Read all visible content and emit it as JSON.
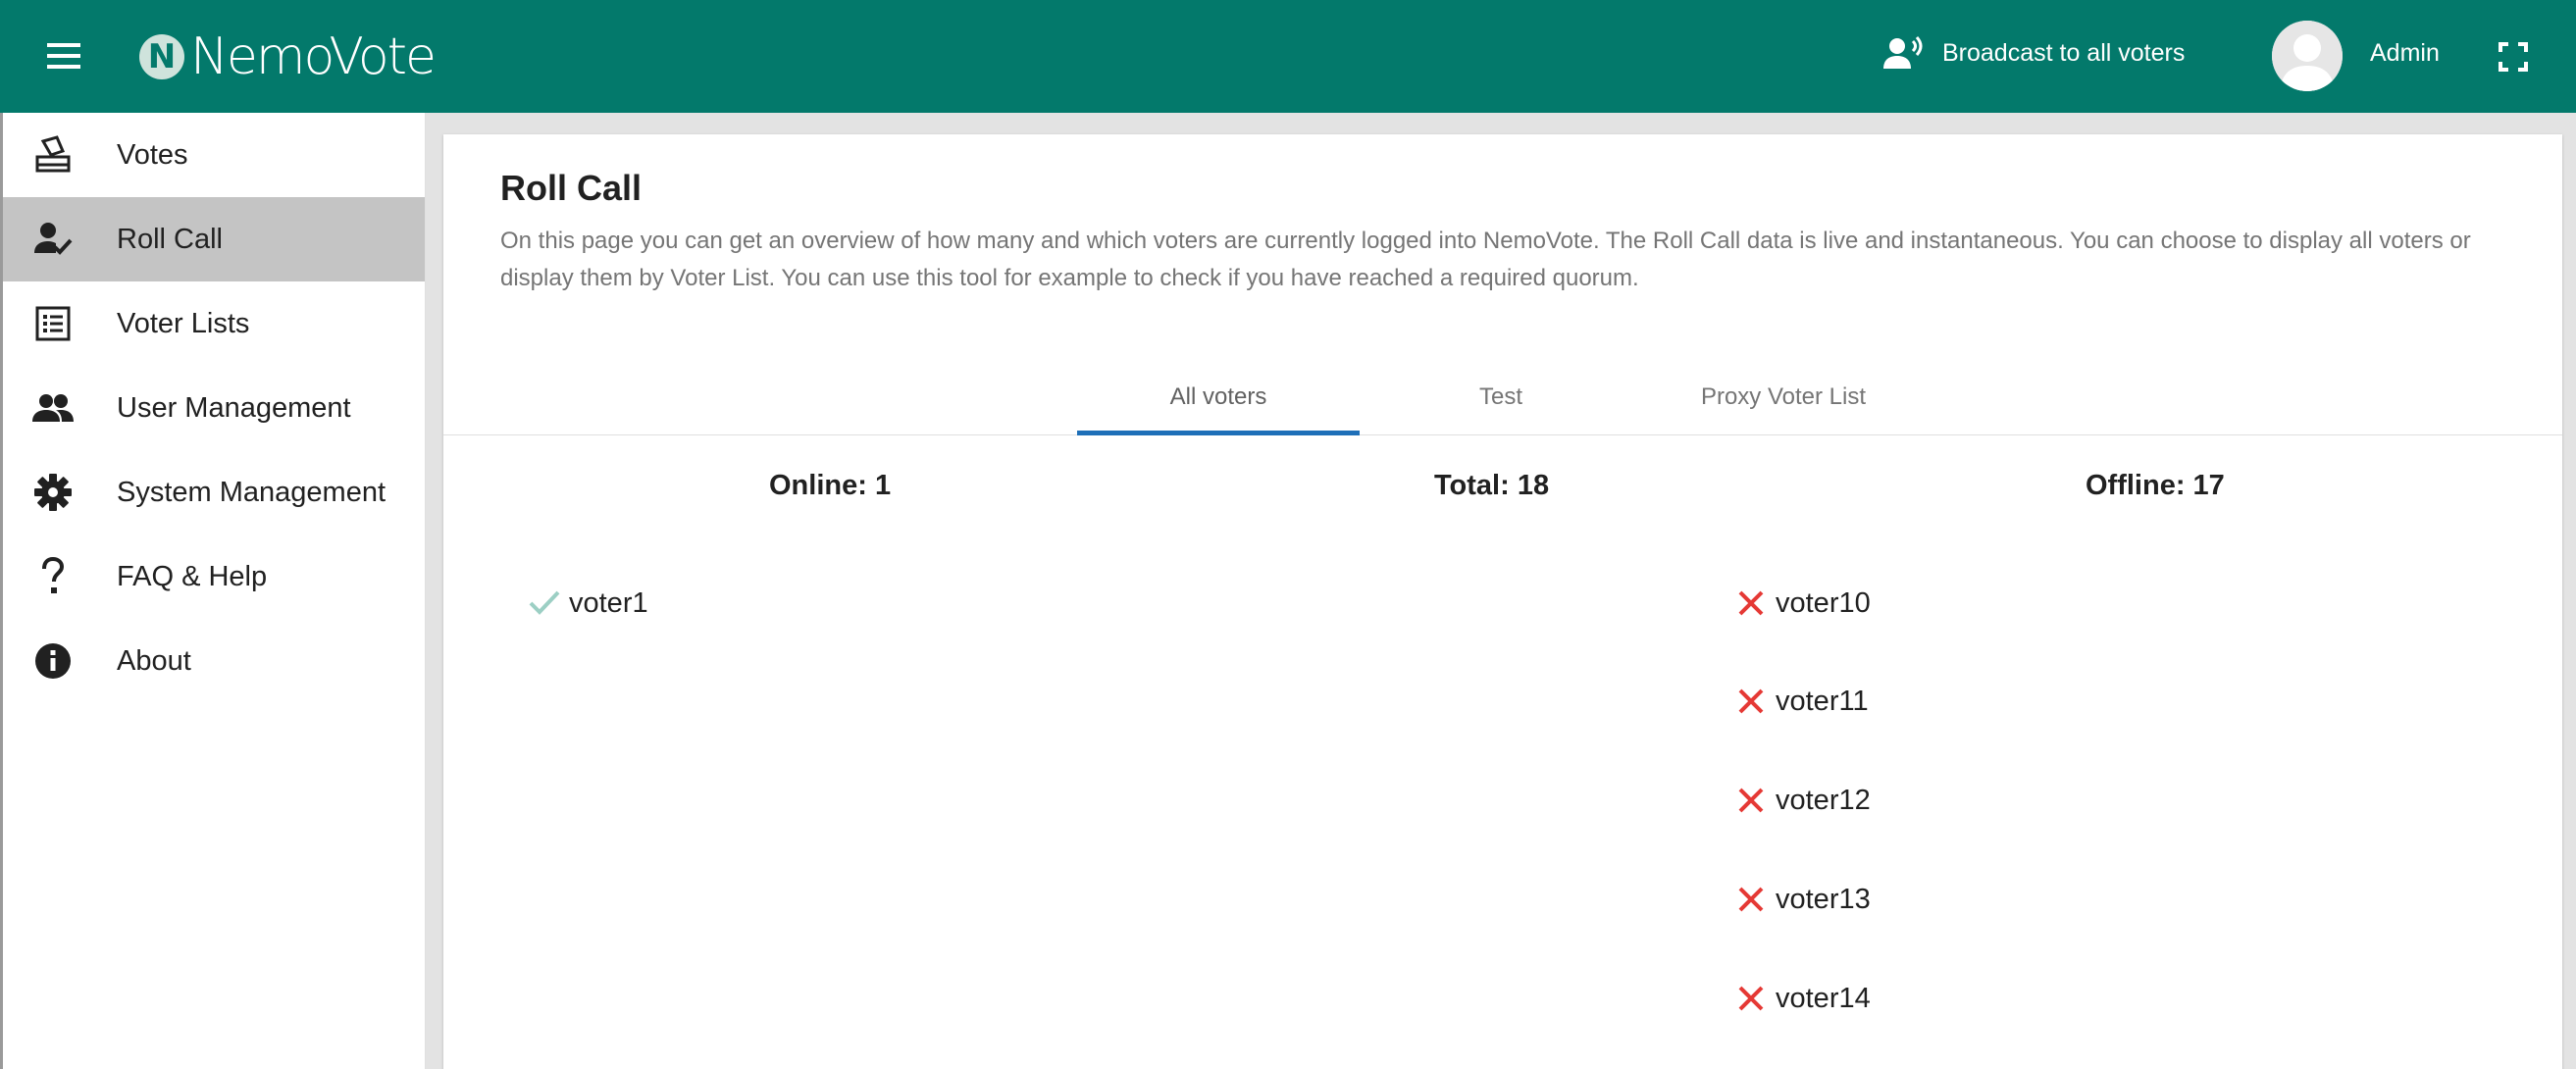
{
  "app": {
    "logo_letter": "N",
    "logo_text": "NemoVote",
    "brand_color": "#03796b"
  },
  "header": {
    "broadcast_label": "Broadcast to all voters",
    "user_label": "Admin"
  },
  "sidebar": {
    "items": [
      {
        "label": "Votes",
        "icon": "ballot-box-icon"
      },
      {
        "label": "Roll Call",
        "icon": "person-check-icon",
        "active": true
      },
      {
        "label": "Voter Lists",
        "icon": "list-icon"
      },
      {
        "label": "User Management",
        "icon": "people-icon"
      },
      {
        "label": "System Management",
        "icon": "gear-icon"
      },
      {
        "label": "FAQ & Help",
        "icon": "question-icon"
      },
      {
        "label": "About",
        "icon": "info-icon"
      }
    ]
  },
  "page": {
    "title": "Roll Call",
    "description": "On this page you can get an overview of how many and which voters are currently logged into NemoVote. The Roll Call data is live and instantaneous. You can choose to display all voters or display them by Voter List. You can use this tool for example to check if you have reached a required quorum."
  },
  "tabs": [
    {
      "label": "All voters",
      "active": true
    },
    {
      "label": "Test"
    },
    {
      "label": "Proxy Voter List"
    }
  ],
  "stats": {
    "online": "Online: 1",
    "total": "Total: 18",
    "offline": "Offline: 17"
  },
  "online_voters": [
    "voter1"
  ],
  "offline_voters": [
    "voter10",
    "voter11",
    "voter12",
    "voter13",
    "voter14"
  ],
  "colors": {
    "online_check": "#9ccfc4",
    "offline_x": "#e53935",
    "tab_indicator": "#1e6fb8"
  }
}
